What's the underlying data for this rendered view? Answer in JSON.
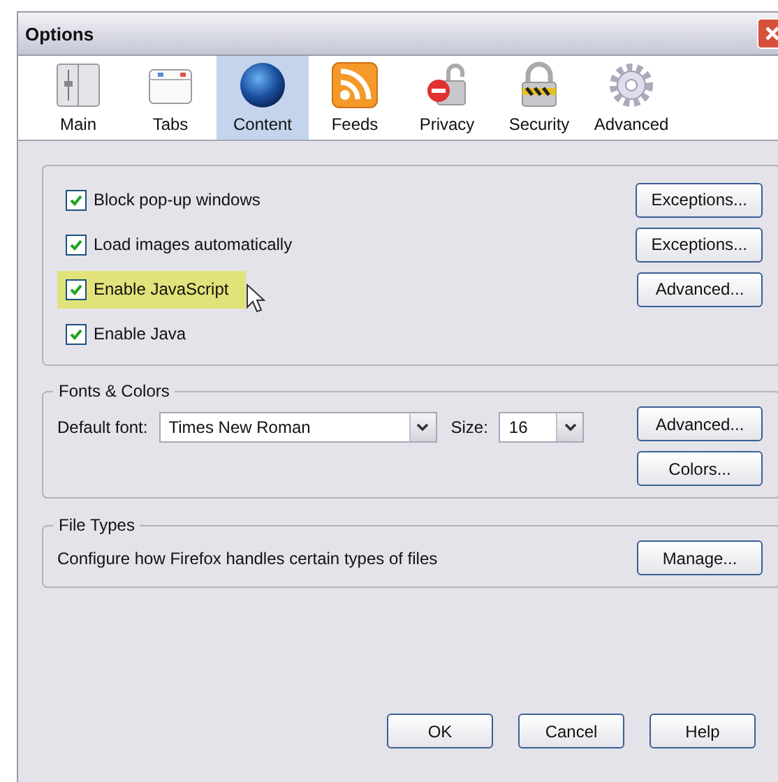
{
  "window": {
    "title": "Options"
  },
  "tabs": [
    {
      "label": "Main",
      "selected": false
    },
    {
      "label": "Tabs",
      "selected": false
    },
    {
      "label": "Content",
      "selected": true
    },
    {
      "label": "Feeds",
      "selected": false
    },
    {
      "label": "Privacy",
      "selected": false
    },
    {
      "label": "Security",
      "selected": false
    },
    {
      "label": "Advanced",
      "selected": false
    }
  ],
  "content_options": [
    {
      "label": "Block pop-up windows",
      "checked": true,
      "highlighted": false,
      "button": "Exceptions..."
    },
    {
      "label": "Load images automatically",
      "checked": true,
      "highlighted": false,
      "button": "Exceptions..."
    },
    {
      "label": "Enable JavaScript",
      "checked": true,
      "highlighted": true,
      "button": "Advanced..."
    },
    {
      "label": "Enable Java",
      "checked": true,
      "highlighted": false
    }
  ],
  "fonts_colors": {
    "title": "Fonts & Colors",
    "default_font_label": "Default font:",
    "default_font": "Times New Roman",
    "size_label": "Size:",
    "size": "16",
    "buttons": [
      "Advanced...",
      "Colors..."
    ]
  },
  "file_types": {
    "title": "File Types",
    "description": "Configure how Firefox handles certain types of files",
    "button": "Manage..."
  },
  "buttons": [
    "OK",
    "Cancel",
    "Help"
  ]
}
